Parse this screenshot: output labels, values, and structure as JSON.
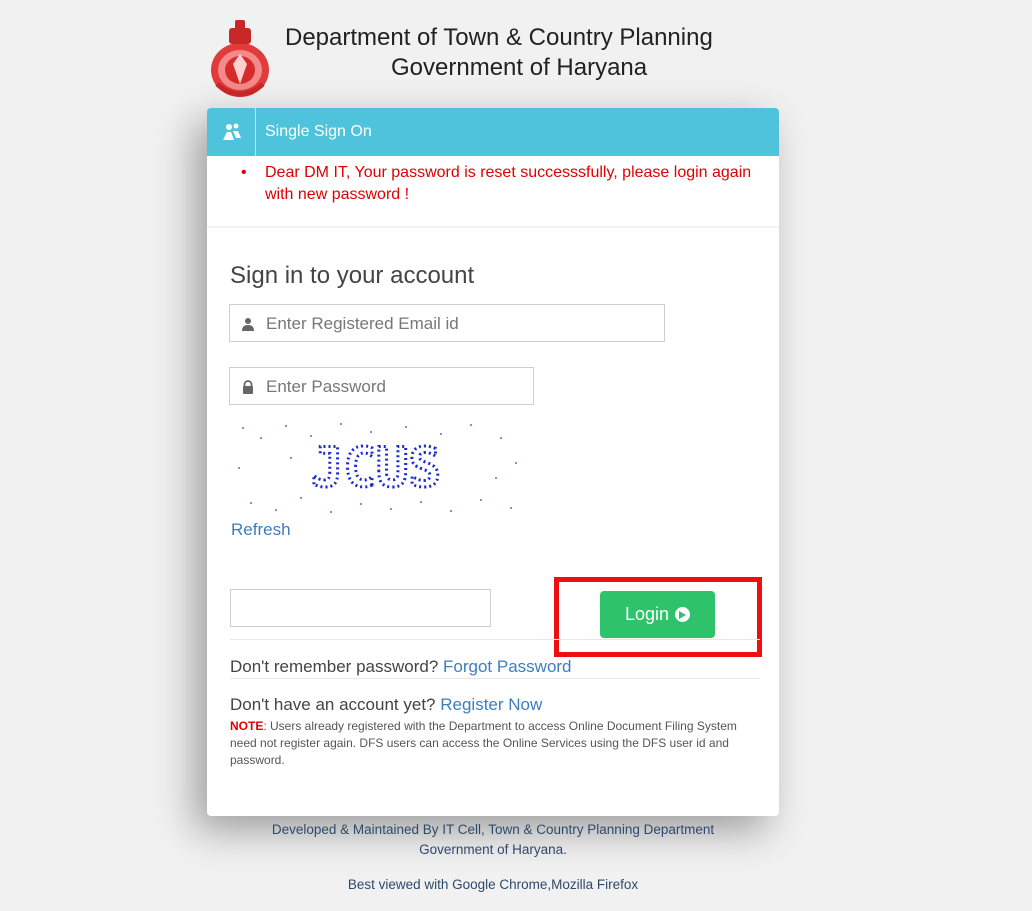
{
  "header": {
    "title_line1": "Department of Town & Country Planning",
    "title_line2": "Government of Haryana"
  },
  "card": {
    "header_title": "Single Sign On",
    "alert_message": "Dear DM IT, Your password is reset successsfully, please login again with new password !",
    "signin_title": "Sign in to your account",
    "email_placeholder": "Enter Registered Email id",
    "password_placeholder": "Enter Password",
    "captcha_text": "JCUS",
    "refresh_label": "Refresh",
    "captcha_input_value": "",
    "login_label": "Login",
    "forgot_prompt": "Don't remember password?",
    "forgot_link": "Forgot Password",
    "register_prompt": "Don't have an account yet?",
    "register_link": "Register Now",
    "note_label": "NOTE",
    "note_text": ": Users already registered with the Department to access Online Document Filing System need not register again. DFS users can access the Online Services using the DFS user id and password."
  },
  "footer": {
    "line1": "Developed & Maintained By IT Cell, Town & Country Planning Department",
    "line2": "Government of Haryana.",
    "line3": "Best viewed with Google Chrome,Mozilla Firefox"
  },
  "colors": {
    "header_bar": "#4fc3dc",
    "alert_text": "#e00000",
    "login_button": "#2ec26a",
    "highlight_box": "#ee1010",
    "link": "#3d7ec0"
  }
}
